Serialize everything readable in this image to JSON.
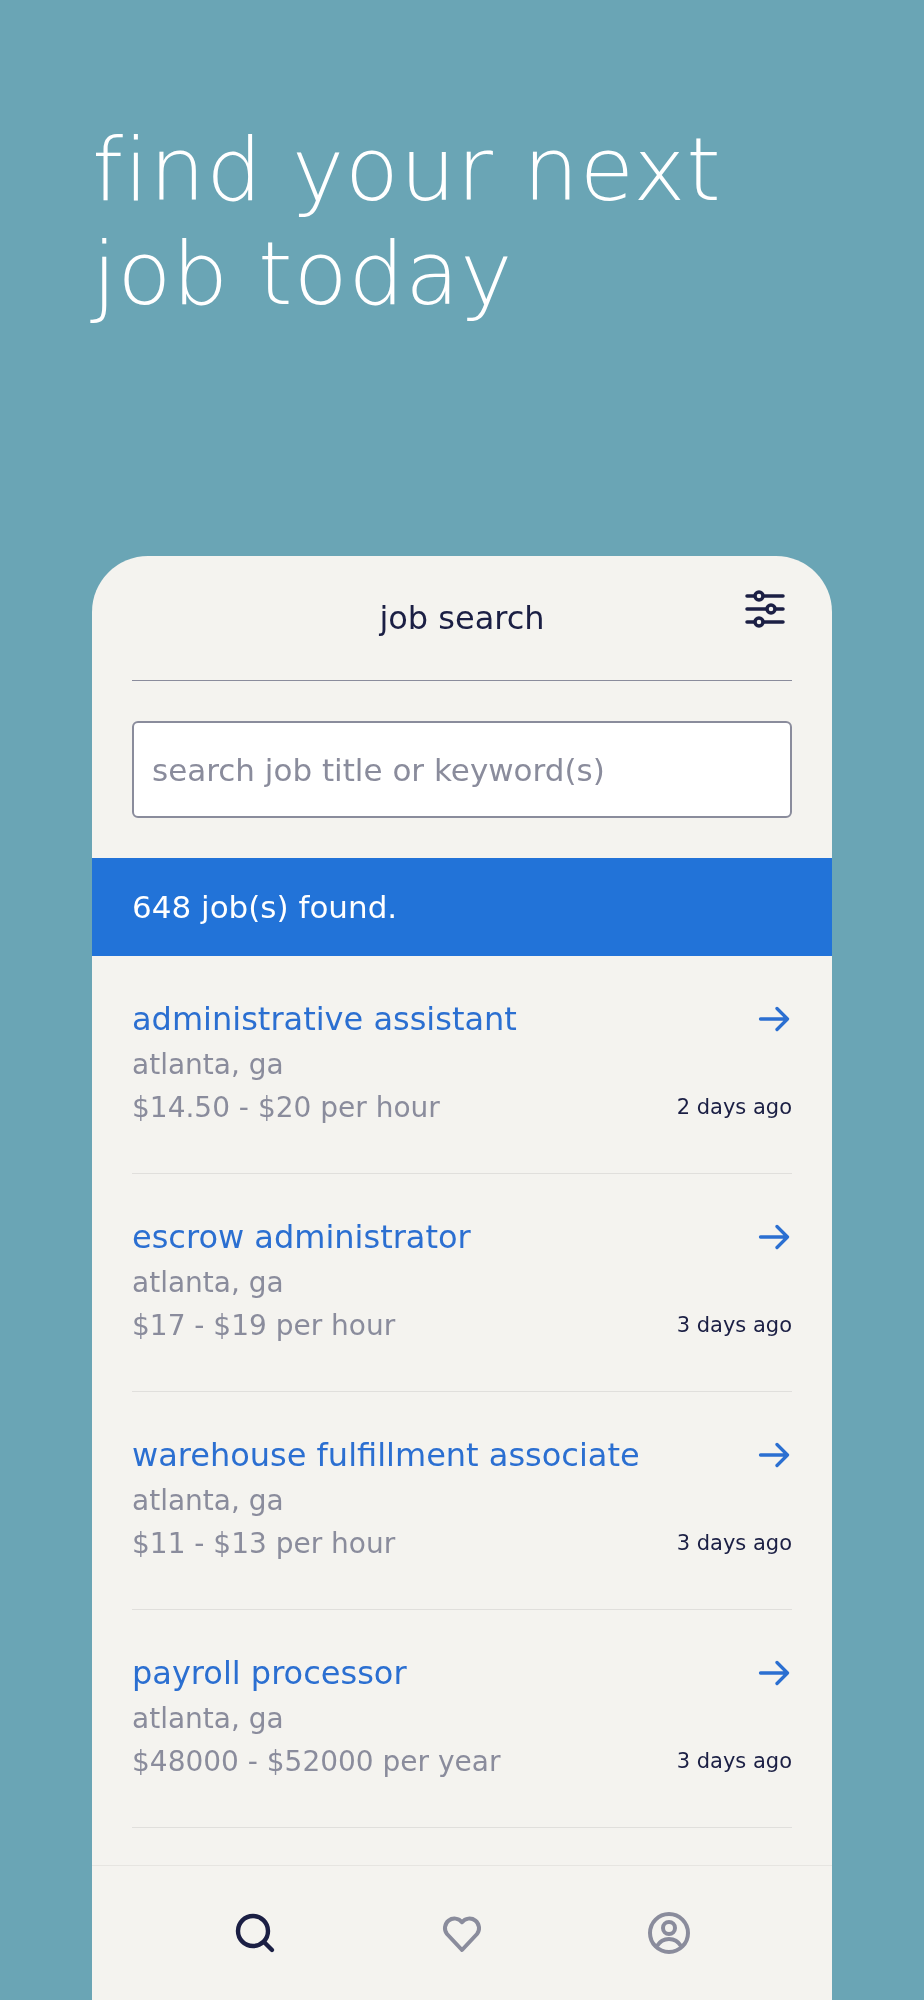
{
  "headline": [
    "find your next",
    "job today"
  ],
  "header": {
    "title": "job search"
  },
  "search": {
    "placeholder": "search job title or keyword(s)"
  },
  "results_banner": "648 job(s) found.",
  "jobs": [
    {
      "title": "administrative assistant",
      "location": "atlanta, ga",
      "pay": "$14.50 - $20 per hour",
      "posted": "2 days ago"
    },
    {
      "title": "escrow administrator",
      "location": "atlanta, ga",
      "pay": "$17 - $19 per hour",
      "posted": "3 days ago"
    },
    {
      "title": "warehouse fulfillment associate",
      "location": "atlanta, ga",
      "pay": "$11 - $13 per hour",
      "posted": "3 days ago"
    },
    {
      "title": "payroll processor",
      "location": "atlanta, ga",
      "pay": "$48000 - $52000 per year",
      "posted": "3 days ago"
    }
  ],
  "nav": [
    {
      "kind": "search",
      "selected": true
    },
    {
      "kind": "favorites",
      "selected": false
    },
    {
      "kind": "profile",
      "selected": false
    }
  ]
}
